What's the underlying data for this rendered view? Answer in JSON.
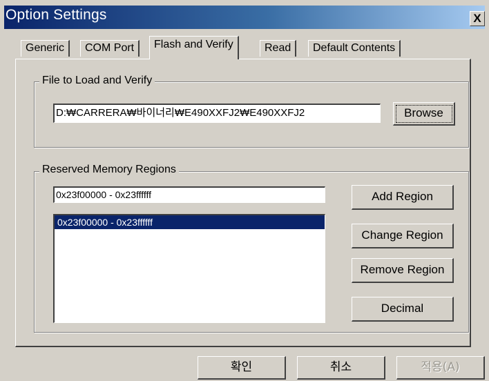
{
  "window": {
    "title": "Option Settings",
    "close_glyph": "X"
  },
  "tabs": [
    {
      "label": "Generic",
      "active": false
    },
    {
      "label": "COM Port",
      "active": false
    },
    {
      "label": "Flash and Verify",
      "active": true
    },
    {
      "label": "Read",
      "active": false
    },
    {
      "label": "Default Contents",
      "active": false
    }
  ],
  "file_group": {
    "label": "File to Load and Verify",
    "path_value": "D:₩CARRERA₩바이너리₩E490XXFJ2₩E490XXFJ2",
    "browse_label": "Browse"
  },
  "memory_group": {
    "label": "Reserved Memory Regions",
    "region_input_value": "0x23f00000 - 0x23ffffff",
    "list_items": [
      {
        "text": "0x23f00000 - 0x23ffffff",
        "selected": true
      }
    ],
    "add_label": "Add Region",
    "change_label": "Change Region",
    "remove_label": "Remove Region",
    "decimal_label": "Decimal"
  },
  "footer": {
    "ok_label": "확인",
    "cancel_label": "취소",
    "apply_label": "적용(A)",
    "apply_enabled": false
  },
  "colors": {
    "face": "#d4d0c8",
    "title_start": "#0a246a",
    "title_end": "#a6caf0",
    "selection": "#0a246a"
  }
}
